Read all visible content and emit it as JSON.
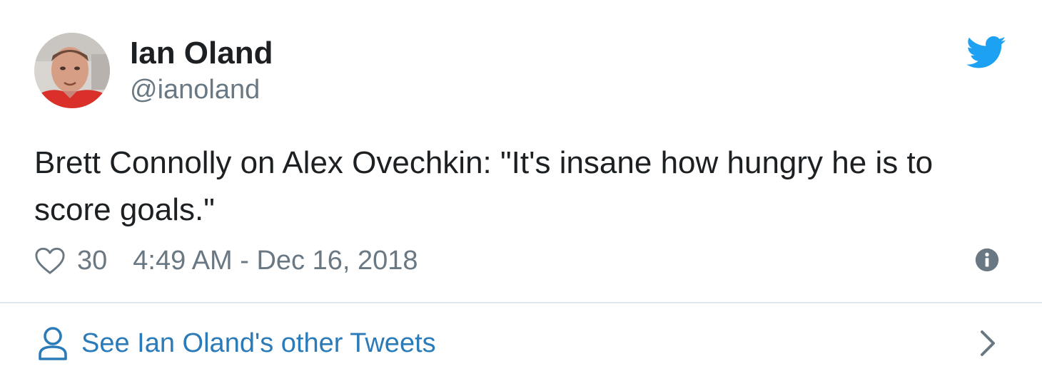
{
  "author": {
    "display_name": "Ian Oland",
    "screen_name": "@ianoland",
    "avatar_icon": "avatar-photo"
  },
  "tweet": {
    "text": "Brett Connolly on Alex Ovechkin: \"It's insane how hungry he is to score goals.\"",
    "like_count": "30",
    "timestamp": "4:49 AM - Dec 16, 2018"
  },
  "icons": {
    "brand": "twitter-bird-icon",
    "like": "heart-icon",
    "info": "info-icon",
    "profile": "person-icon",
    "more": "chevron-right-icon"
  },
  "footer": {
    "other_tweets_label": "See Ian Oland's other Tweets"
  },
  "colors": {
    "twitter_blue": "#1da1f2",
    "link_blue": "#2b7bb9",
    "text": "#1c2022",
    "muted": "#697882",
    "divider": "#e1e8ed"
  }
}
